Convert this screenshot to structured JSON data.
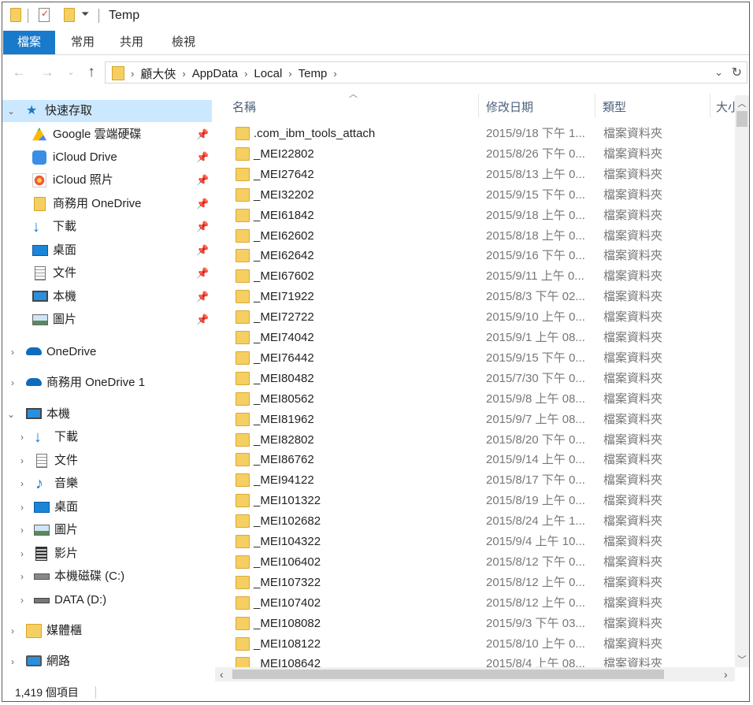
{
  "window": {
    "title": "Temp"
  },
  "ribbon": {
    "tabs": [
      "檔案",
      "常用",
      "共用",
      "檢視"
    ]
  },
  "address": {
    "path": [
      "顧大俠",
      "AppData",
      "Local",
      "Temp"
    ]
  },
  "columns": {
    "name": "名稱",
    "date": "修改日期",
    "type": "類型",
    "size": "大小"
  },
  "nav": {
    "quick_access": {
      "label": "快速存取",
      "items": [
        {
          "label": "Google 雲端硬碟",
          "icon": "google-drive-icon"
        },
        {
          "label": "iCloud Drive",
          "icon": "icloud-drive-icon"
        },
        {
          "label": "iCloud 照片",
          "icon": "icloud-photos-icon"
        },
        {
          "label": "商務用 OneDrive",
          "icon": "folder-icon"
        },
        {
          "label": "下載",
          "icon": "download-icon"
        },
        {
          "label": "桌面",
          "icon": "desktop-icon"
        },
        {
          "label": "文件",
          "icon": "documents-icon"
        },
        {
          "label": "本機",
          "icon": "computer-icon"
        },
        {
          "label": "圖片",
          "icon": "pictures-icon"
        }
      ]
    },
    "onedrive": "OneDrive",
    "onedrive_business": "商務用 OneDrive 1",
    "this_pc": {
      "label": "本機",
      "items": [
        {
          "label": "下載",
          "icon": "download-icon"
        },
        {
          "label": "文件",
          "icon": "documents-icon"
        },
        {
          "label": "音樂",
          "icon": "music-icon"
        },
        {
          "label": "桌面",
          "icon": "desktop-icon"
        },
        {
          "label": "圖片",
          "icon": "pictures-icon"
        },
        {
          "label": "影片",
          "icon": "videos-icon"
        },
        {
          "label": "本機磁碟 (C:)",
          "icon": "local-disk-icon"
        },
        {
          "label": "DATA (D:)",
          "icon": "drive-icon"
        }
      ]
    },
    "libraries": "媒體櫃",
    "network": "網路"
  },
  "files": [
    {
      "name": ".com_ibm_tools_attach",
      "date": "2015/9/18 下午 1...",
      "type": "檔案資料夾"
    },
    {
      "name": "_MEI22802",
      "date": "2015/8/26 下午 0...",
      "type": "檔案資料夾"
    },
    {
      "name": "_MEI27642",
      "date": "2015/8/13 上午 0...",
      "type": "檔案資料夾"
    },
    {
      "name": "_MEI32202",
      "date": "2015/9/15 下午 0...",
      "type": "檔案資料夾"
    },
    {
      "name": "_MEI61842",
      "date": "2015/9/18 上午 0...",
      "type": "檔案資料夾"
    },
    {
      "name": "_MEI62602",
      "date": "2015/8/18 上午 0...",
      "type": "檔案資料夾"
    },
    {
      "name": "_MEI62642",
      "date": "2015/9/16 下午 0...",
      "type": "檔案資料夾"
    },
    {
      "name": "_MEI67602",
      "date": "2015/9/11 上午 0...",
      "type": "檔案資料夾"
    },
    {
      "name": "_MEI71922",
      "date": "2015/8/3 下午 02...",
      "type": "檔案資料夾"
    },
    {
      "name": "_MEI72722",
      "date": "2015/9/10 上午 0...",
      "type": "檔案資料夾"
    },
    {
      "name": "_MEI74042",
      "date": "2015/9/1 上午 08...",
      "type": "檔案資料夾"
    },
    {
      "name": "_MEI76442",
      "date": "2015/9/15 下午 0...",
      "type": "檔案資料夾"
    },
    {
      "name": "_MEI80482",
      "date": "2015/7/30 下午 0...",
      "type": "檔案資料夾"
    },
    {
      "name": "_MEI80562",
      "date": "2015/9/8 上午 08...",
      "type": "檔案資料夾"
    },
    {
      "name": "_MEI81962",
      "date": "2015/9/7 上午 08...",
      "type": "檔案資料夾"
    },
    {
      "name": "_MEI82802",
      "date": "2015/8/20 下午 0...",
      "type": "檔案資料夾"
    },
    {
      "name": "_MEI86762",
      "date": "2015/9/14 上午 0...",
      "type": "檔案資料夾"
    },
    {
      "name": "_MEI94122",
      "date": "2015/8/17 下午 0...",
      "type": "檔案資料夾"
    },
    {
      "name": "_MEI101322",
      "date": "2015/8/19 上午 0...",
      "type": "檔案資料夾"
    },
    {
      "name": "_MEI102682",
      "date": "2015/8/24 上午 1...",
      "type": "檔案資料夾"
    },
    {
      "name": "_MEI104322",
      "date": "2015/9/4 上午 10...",
      "type": "檔案資料夾"
    },
    {
      "name": "_MEI106402",
      "date": "2015/8/12 下午 0...",
      "type": "檔案資料夾"
    },
    {
      "name": "_MEI107322",
      "date": "2015/8/12 上午 0...",
      "type": "檔案資料夾"
    },
    {
      "name": "_MEI107402",
      "date": "2015/8/12 上午 0...",
      "type": "檔案資料夾"
    },
    {
      "name": "_MEI108082",
      "date": "2015/9/3 下午 03...",
      "type": "檔案資料夾"
    },
    {
      "name": "_MEI108122",
      "date": "2015/8/10 上午 0...",
      "type": "檔案資料夾"
    },
    {
      "name": "_MEI108642",
      "date": "2015/8/4 上午 08...",
      "type": "檔案資料夾"
    }
  ],
  "status": {
    "count": "1,419 個項目"
  },
  "colors": {
    "accent": "#1979ca",
    "selected": "#cce8ff",
    "folder": "#f5cf62"
  }
}
